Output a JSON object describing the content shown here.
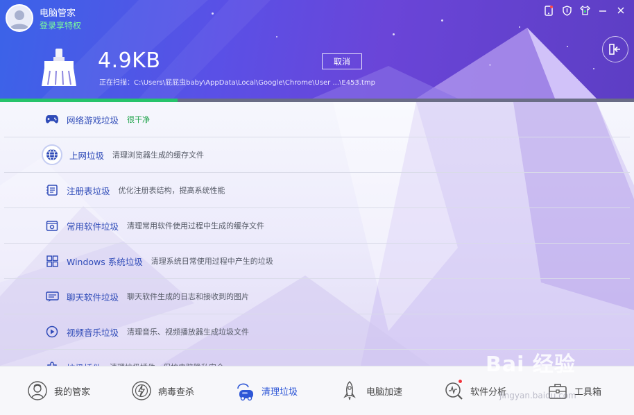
{
  "header": {
    "app_title": "电脑管家",
    "login_link": "登录享特权",
    "scan_size": "4.9KB",
    "scan_path": "正在扫描：C:\\Users\\屁屁虫baby\\AppData\\Local\\Google\\Chrome\\User ...\\E453.tmp",
    "cancel_label": "取消",
    "progress_percent": 28
  },
  "window_controls": [
    "phone-icon",
    "shield-icon",
    "shirt-icon",
    "minimize-icon",
    "close-icon"
  ],
  "items": [
    {
      "name": "网络游戏垃圾",
      "desc": "很干净",
      "icon": "gamepad-icon",
      "clean": true
    },
    {
      "name": "上网垃圾",
      "desc": "清理浏览器生成的缓存文件",
      "icon": "globe-icon",
      "active": true
    },
    {
      "name": "注册表垃圾",
      "desc": "优化注册表结构，提高系统性能",
      "icon": "registry-icon"
    },
    {
      "name": "常用软件垃圾",
      "desc": "清理常用软件使用过程中生成的缓存文件",
      "icon": "software-icon"
    },
    {
      "name": "Windows 系统垃圾",
      "desc": "清理系统日常使用过程中产生的垃圾",
      "icon": "windows-icon"
    },
    {
      "name": "聊天软件垃圾",
      "desc": "聊天软件生成的日志和接收到的图片",
      "icon": "chat-icon"
    },
    {
      "name": "视频音乐垃圾",
      "desc": "清理音乐、视频播放器生成垃圾文件",
      "icon": "play-icon"
    },
    {
      "name": "垃圾插件",
      "desc": "清理垃圾插件，保护电脑隐私安全",
      "icon": "plugin-icon"
    }
  ],
  "nav": [
    {
      "label": "我的管家",
      "icon": "butler-icon"
    },
    {
      "label": "病毒查杀",
      "icon": "virus-scan-icon"
    },
    {
      "label": "清理垃圾",
      "icon": "vacuum-icon",
      "active": true
    },
    {
      "label": "电脑加速",
      "icon": "rocket-icon"
    },
    {
      "label": "软件分析",
      "icon": "analysis-icon",
      "badge": true
    },
    {
      "label": "工具箱",
      "icon": "toolbox-icon"
    }
  ],
  "watermark": {
    "text": "Bai 经验",
    "sub": "jingyan.baidu.com"
  },
  "colors": {
    "accent": "#2d56d6",
    "progress": "#27c36b",
    "clean_text": "#1ea34a",
    "login_link": "#7cff9a"
  }
}
